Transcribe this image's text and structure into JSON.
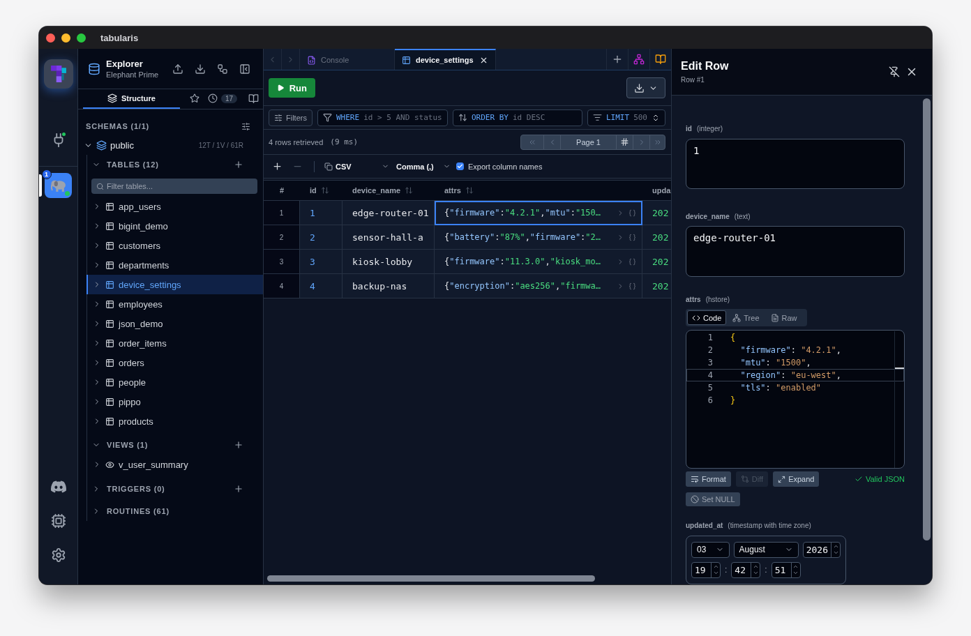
{
  "window": {
    "title": "tabularis"
  },
  "rail": {
    "connection_badge": "1",
    "connection_online": true,
    "connection_selected": true
  },
  "explorer": {
    "title": "Explorer",
    "subtitle": "Elephant Prime",
    "tabs": [
      {
        "kind": "structure",
        "label": "Structure",
        "selected": true
      },
      {
        "kind": "favorites",
        "selected": false
      },
      {
        "kind": "history",
        "count": "17",
        "selected": false
      },
      {
        "kind": "docs",
        "selected": false
      }
    ],
    "schemas_heading": "SCHEMAS (1/1)",
    "schema": {
      "name": "public",
      "stats": "12T / 1V / 61R",
      "expanded": true
    },
    "sections": [
      {
        "kind": "tables",
        "heading": "TABLES (12)",
        "expanded": true,
        "addable": true,
        "filter_placeholder": "Filter tables...",
        "items": [
          {
            "name": "app_users",
            "selected": false
          },
          {
            "name": "bigint_demo",
            "selected": false
          },
          {
            "name": "customers",
            "selected": false
          },
          {
            "name": "departments",
            "selected": false
          },
          {
            "name": "device_settings",
            "selected": true
          },
          {
            "name": "employees",
            "selected": false
          },
          {
            "name": "json_demo",
            "selected": false
          },
          {
            "name": "order_items",
            "selected": false
          },
          {
            "name": "orders",
            "selected": false
          },
          {
            "name": "people",
            "selected": false
          },
          {
            "name": "pippo",
            "selected": false
          },
          {
            "name": "products",
            "selected": false
          }
        ]
      },
      {
        "kind": "views",
        "heading": "VIEWS (1)",
        "expanded": true,
        "addable": true,
        "items": [
          {
            "name": "v_user_summary",
            "selected": false
          }
        ]
      },
      {
        "kind": "triggers",
        "heading": "TRIGGERS (0)",
        "expanded": false,
        "addable": true
      },
      {
        "kind": "routines",
        "heading": "ROUTINES (61)",
        "expanded": false,
        "addable": false
      }
    ]
  },
  "editor": {
    "tabs": [
      {
        "kind": "console",
        "label": "Console",
        "selected": false
      },
      {
        "kind": "table",
        "label": "device_settings",
        "selected": true
      }
    ],
    "run_label": "Run",
    "filters": {
      "label": "Filters",
      "where": {
        "keyword": "WHERE",
        "placeholder": "id > 5 AND status"
      },
      "order": {
        "keyword": "ORDER BY",
        "placeholder": "id DESC"
      },
      "limit": {
        "keyword": "LIMIT",
        "placeholder": "500"
      }
    },
    "result": {
      "summary": "4 rows retrieved",
      "timing": "(9 ms)",
      "page": "Page 1"
    },
    "export": {
      "format": "CSV",
      "delimiter": "Comma (,)",
      "headers_label": "Export column names",
      "headers_checked": true
    },
    "table": {
      "columns": [
        {
          "label": "#",
          "sortable": false
        },
        {
          "label": "id",
          "sortable": true
        },
        {
          "label": "device_name",
          "sortable": true
        },
        {
          "label": "attrs",
          "sortable": true
        },
        {
          "label": "upda",
          "sortable": false
        }
      ],
      "rows": [
        {
          "num": "1",
          "id": "1",
          "device_name": "edge-router-01",
          "attrs": "{\"firmware\":\"4.2.1\",\"mtu\":\"150…",
          "updated_at": "202",
          "selected": true
        },
        {
          "num": "2",
          "id": "2",
          "device_name": "sensor-hall-a",
          "attrs": "{\"battery\":\"87%\",\"firmware\":\"2…",
          "updated_at": "202",
          "selected": false
        },
        {
          "num": "3",
          "id": "3",
          "device_name": "kiosk-lobby",
          "attrs": "{\"firmware\":\"11.3.0\",\"kiosk_mo…",
          "updated_at": "202",
          "selected": false
        },
        {
          "num": "4",
          "id": "4",
          "device_name": "backup-nas",
          "attrs": "{\"encryption\":\"aes256\",\"firmwa…",
          "updated_at": "202",
          "selected": false
        }
      ]
    }
  },
  "edit_row": {
    "title": "Edit Row",
    "subtitle": "Row #1",
    "fields": [
      {
        "kind": "text",
        "name": "id",
        "type": "(integer)",
        "value": "1"
      },
      {
        "kind": "text",
        "name": "device_name",
        "type": "(text)",
        "value": "edge-router-01"
      },
      {
        "kind": "json",
        "name": "attrs",
        "type": "(hstore)",
        "modes": [
          {
            "kind": "code",
            "label": "Code",
            "selected": true
          },
          {
            "kind": "tree",
            "label": "Tree",
            "selected": false
          },
          {
            "kind": "raw",
            "label": "Raw",
            "selected": false
          }
        ],
        "lines": [
          {
            "number": "1",
            "text": "{",
            "active": false
          },
          {
            "number": "2",
            "text": "  \"firmware\": \"4.2.1\",",
            "active": false
          },
          {
            "number": "3",
            "text": "  \"mtu\": \"1500\",",
            "active": false
          },
          {
            "number": "4",
            "text": "  \"region\": \"eu-west\",",
            "active": true
          },
          {
            "number": "5",
            "text": "  \"tls\": \"enabled\"",
            "active": false
          },
          {
            "number": "6",
            "text": "}",
            "active": false
          }
        ],
        "actions": [
          {
            "kind": "format",
            "label": "Format",
            "disabled": false
          },
          {
            "kind": "diff",
            "label": "Diff",
            "disabled": true
          },
          {
            "kind": "expand",
            "label": "Expand",
            "disabled": false
          }
        ],
        "validity": "Valid JSON",
        "valid": true,
        "null_label": "Set NULL"
      },
      {
        "kind": "timestamp",
        "name": "updated_at",
        "type": "(timestamp with time zone)",
        "day": "03",
        "month": "August",
        "year": "2026",
        "time": [
          {
            "kind": "spin",
            "value": "19"
          },
          {
            "kind": "sep",
            "value": ":"
          },
          {
            "kind": "spin",
            "value": "42"
          },
          {
            "kind": "sep",
            "value": ":"
          },
          {
            "kind": "spin",
            "value": "51"
          }
        ]
      }
    ]
  }
}
